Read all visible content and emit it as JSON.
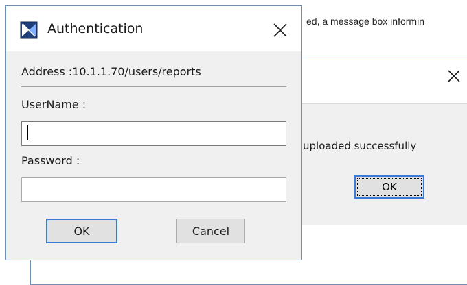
{
  "background": {
    "partial_text": "ed, a message box informin",
    "message_box": {
      "message": "uploaded successfully",
      "ok_label": "OK"
    }
  },
  "dialog": {
    "title": "Authentication",
    "address": "Address :10.1.1.70/users/reports",
    "username_label": "UserName :",
    "username_value": "",
    "password_label": "Password :",
    "password_value": "",
    "ok_label": "OK",
    "cancel_label": "Cancel"
  },
  "icons": {
    "app": "app-logo-icon",
    "close": "close-icon"
  },
  "colors": {
    "accent": "#3a7bd5",
    "dialog_body": "#f0f0f0",
    "window_border": "#6f8fb3"
  }
}
